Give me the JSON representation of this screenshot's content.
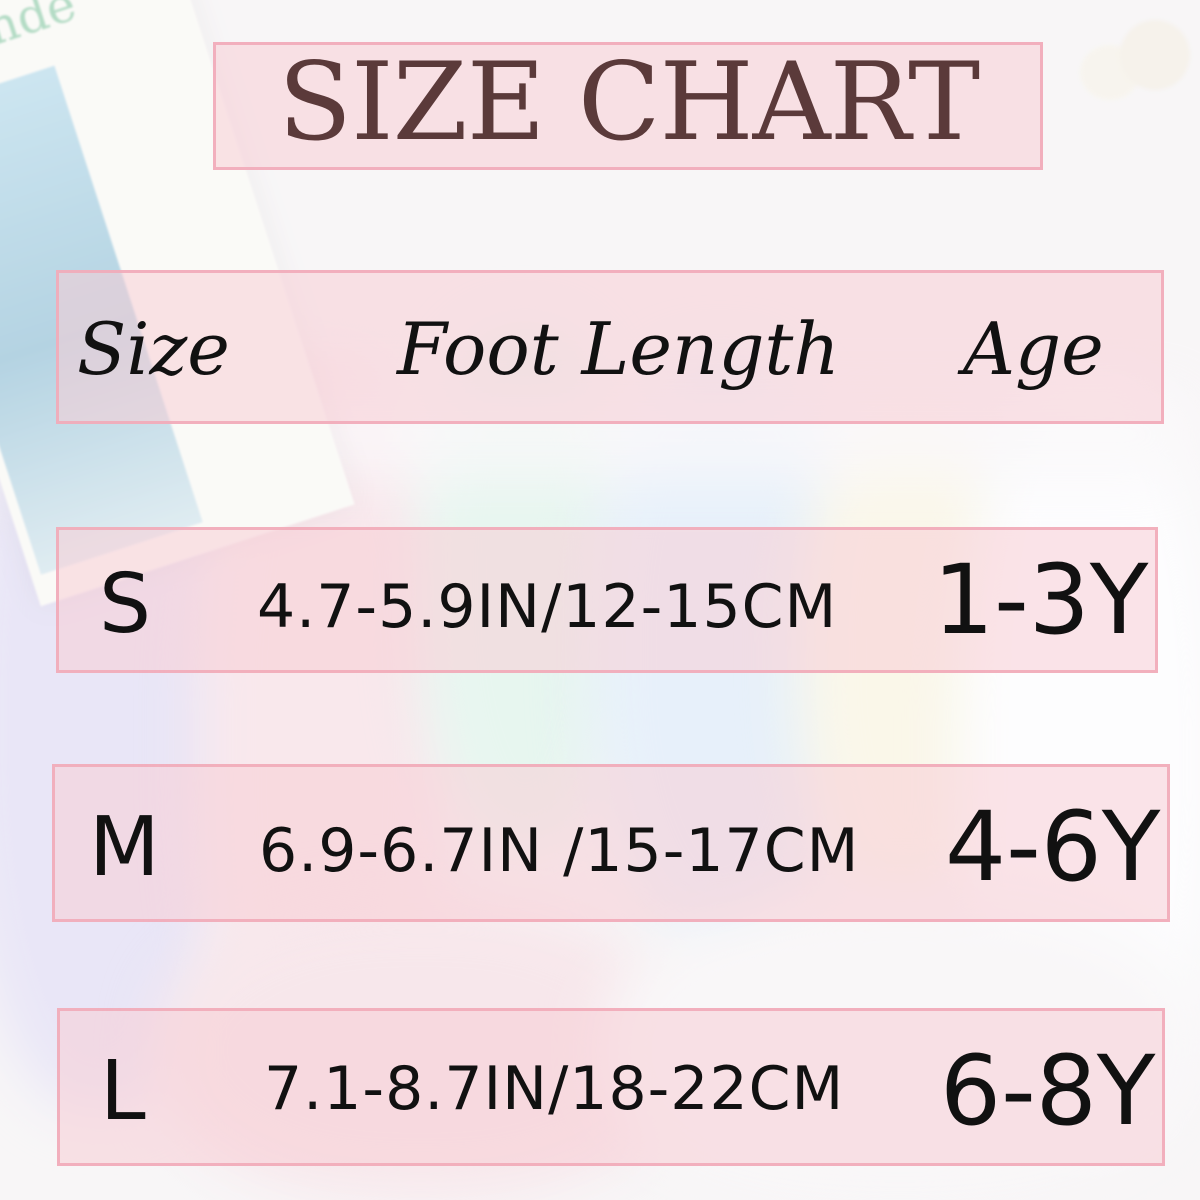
{
  "title": "SIZE CHART",
  "background": {
    "book_title": "Monde"
  },
  "headers": {
    "size": "Size",
    "foot_length": "Foot Length",
    "age": "Age"
  },
  "rows": [
    {
      "size": "S",
      "foot_length": "4.7-5.9IN/12-15CM",
      "age": "1-3Y"
    },
    {
      "size": "M",
      "foot_length": "6.9-6.7IN /15-17CM",
      "age": "4-6Y"
    },
    {
      "size": "L",
      "foot_length": "7.1-8.7IN/18-22CM",
      "age": "6-8Y"
    }
  ],
  "colors": {
    "panel_fill": "#f8cdd6",
    "panel_border": "#f1aab8",
    "title_text": "#5b3a3a",
    "body_text": "#111111"
  }
}
